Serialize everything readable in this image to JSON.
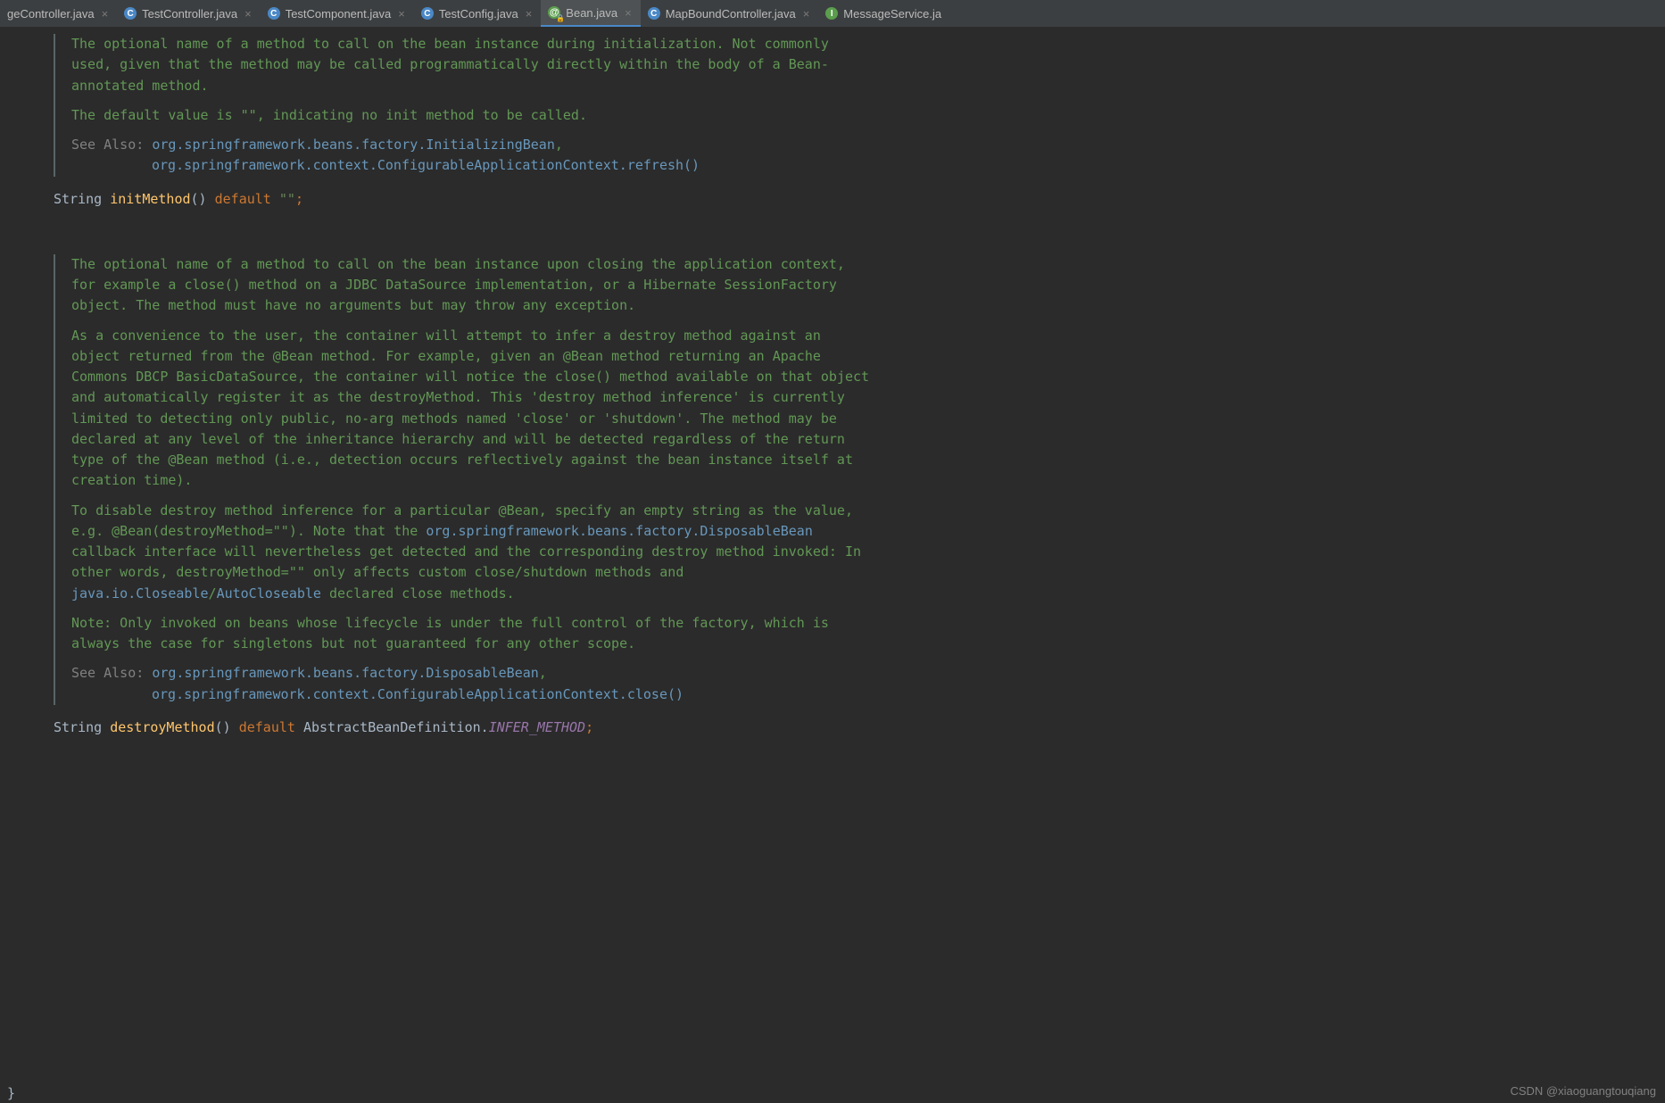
{
  "tabs": [
    {
      "iconType": "c",
      "label": "geController.java"
    },
    {
      "iconType": "c",
      "label": "TestController.java"
    },
    {
      "iconType": "c",
      "label": "TestComponent.java"
    },
    {
      "iconType": "c",
      "label": "TestConfig.java"
    },
    {
      "iconType": "at",
      "label": "Bean.java",
      "active": true,
      "locked": true
    },
    {
      "iconType": "c",
      "label": "MapBoundController.java"
    },
    {
      "iconType": "i",
      "label": "MessageService.ja"
    }
  ],
  "doc1": {
    "p1": "The optional name of a method to call on the bean instance during initialization. Not commonly used, given that the method may be called programmatically directly within the body of a Bean-annotated method.",
    "p2_a": "The default value is ",
    "p2_b": "\"\"",
    "p2_c": ", indicating no init method to be called.",
    "see_label": "See Also: ",
    "link1": "org.springframework.beans.factory.InitializingBean",
    "comma": ",",
    "link2": "org.springframework.context.ConfigurableApplicationContext.refresh()"
  },
  "code1": {
    "type": "String",
    "name": "initMethod",
    "parens": "()",
    "kw": "default",
    "val": "\"\"",
    "semi": ";"
  },
  "doc2": {
    "p1_a": "The optional name of a method to call on the bean instance upon closing the application context, for example a ",
    "p1_b": "close()",
    "p1_c": " method on a JDBC ",
    "p1_d": "DataSource",
    "p1_e": " implementation, or a Hibernate ",
    "p1_f": "SessionFactory",
    "p1_g": " object. The method must have no arguments but may throw any exception.",
    "p2_a": "As a convenience to the user, the container will attempt to infer a destroy method against an object returned from the ",
    "p2_b": "@Bean",
    "p2_c": " method. For example, given an ",
    "p2_d": "@Bean",
    "p2_e": " method returning an Apache Commons DBCP ",
    "p2_f": "BasicDataSource",
    "p2_g": ", the container will notice the ",
    "p2_h": "close()",
    "p2_i": " method available on that object and automatically register it as the ",
    "p2_j": "destroyMethod",
    "p2_k": ". This 'destroy method inference' is currently limited to detecting only public, no-arg methods named 'close' or 'shutdown'. The method may be declared at any level of the inheritance hierarchy and will be detected regardless of the return type of the ",
    "p2_l": "@Bean",
    "p2_m": " method (i.e., detection occurs reflectively against the bean instance itself at creation time).",
    "p3_a": "To disable destroy method inference for a particular ",
    "p3_b": "@Bean",
    "p3_c": ", specify an empty string as the value, e.g. ",
    "p3_d": "@Bean(destroyMethod=\"\")",
    "p3_e": ". Note that the ",
    "p3_link1": "org.springframework.beans.factory.DisposableBean",
    "p3_f": " callback interface will nevertheless get detected and the corresponding destroy method invoked: In other words, ",
    "p3_g": "destroyMethod=\"\"",
    "p3_h": " only affects custom close/shutdown methods and ",
    "p3_link2": "java.io.Closeable",
    "p3_slash": "/",
    "p3_link3": "AutoCloseable",
    "p3_i": " declared close methods.",
    "p4": "Note: Only invoked on beans whose lifecycle is under the full control of the factory, which is always the case for singletons but not guaranteed for any other scope.",
    "see_label": "See Also: ",
    "link1": "org.springframework.beans.factory.DisposableBean",
    "comma": ",",
    "link2": "org.springframework.context.ConfigurableApplicationContext.close()"
  },
  "code2": {
    "type": "String",
    "name": "destroyMethod",
    "parens": "()",
    "kw": "default",
    "cls": "AbstractBeanDefinition.",
    "field": "INFER_METHOD",
    "semi": ";"
  },
  "watermark": "CSDN @xiaoguangtouqiang",
  "brace": "}"
}
